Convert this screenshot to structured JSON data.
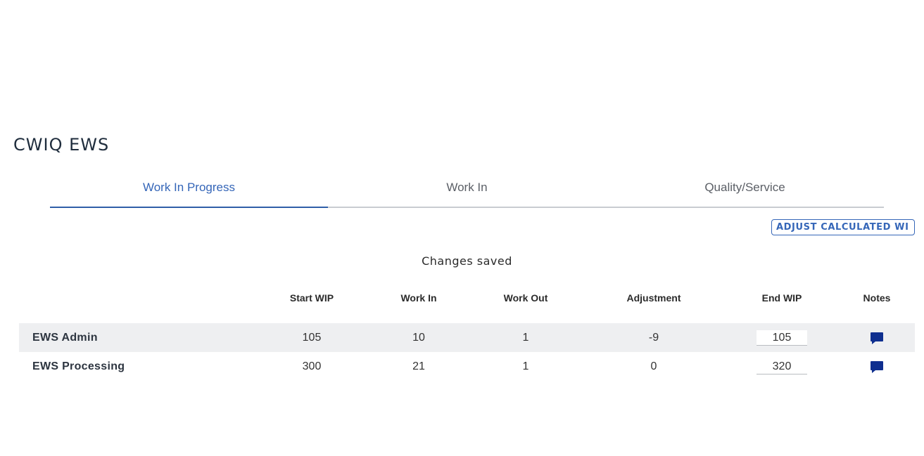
{
  "page_title": "CWIQ EWS",
  "tabs": [
    {
      "label": "Work In Progress",
      "active": true
    },
    {
      "label": "Work In",
      "active": false
    },
    {
      "label": "Quality/Service",
      "active": false
    }
  ],
  "adjust_button_label": "ADJUST CALCULATED WI",
  "status_message": "Changes saved",
  "table": {
    "headers": {
      "start_wip": "Start WIP",
      "work_in": "Work In",
      "work_out": "Work Out",
      "adjustment": "Adjustment",
      "end_wip": "End WIP",
      "notes": "Notes"
    },
    "rows": [
      {
        "name": "EWS Admin",
        "start_wip": "105",
        "work_in": "10",
        "work_out": "1",
        "adjustment": "-9",
        "end_wip": "105",
        "notes_icon": "comment-icon"
      },
      {
        "name": "EWS Processing",
        "start_wip": "300",
        "work_in": "21",
        "work_out": "1",
        "adjustment": "0",
        "end_wip": "320",
        "notes_icon": "comment-icon"
      }
    ]
  },
  "colors": {
    "accent": "#3566b8",
    "note_icon": "#0f2f8f",
    "row_shade": "#eeeff1"
  }
}
